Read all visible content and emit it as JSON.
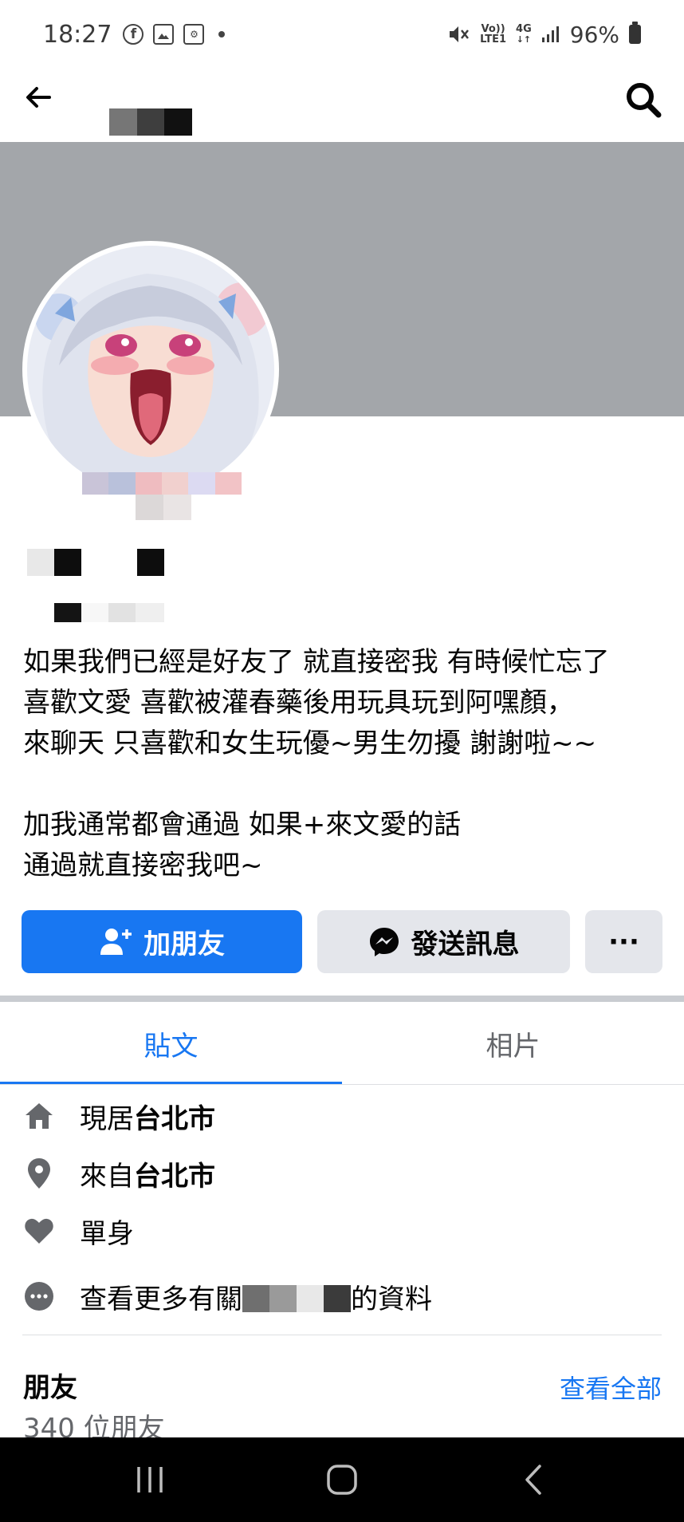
{
  "status_bar": {
    "time": "18:27",
    "left_icons": [
      "facebook-icon",
      "gallery-icon",
      "app-icon"
    ],
    "net_top": "Vo))",
    "net_bottom": "LTE1",
    "net_type": "4G",
    "battery": "96%"
  },
  "header": {
    "back_icon": "back-arrow-icon",
    "search_icon": "search-icon"
  },
  "profile": {
    "bio": "如果我們已經是好友了 就直接密我 有時候忙忘了\n喜歡文愛 喜歡被灌春藥後用玩具玩到阿嘿顏，\n來聊天 只喜歡和女生玩優~男生勿擾 謝謝啦~~\n\n加我通常都會通過 如果+來文愛的話\n通過就直接密我吧~"
  },
  "actions": {
    "add_friend": "加朋友",
    "send_message": "發送訊息",
    "more": "···"
  },
  "tabs": [
    {
      "label": "貼文",
      "active": true
    },
    {
      "label": "相片",
      "active": false
    }
  ],
  "details": {
    "lives_prefix": "現居",
    "lives_city": "台北市",
    "from_prefix": "來自",
    "from_city": "台北市",
    "relationship": "單身",
    "more_prefix": "查看更多有關",
    "more_suffix": "的資料"
  },
  "friends": {
    "title": "朋友",
    "see_all": "查看全部",
    "count": "340 位朋友"
  },
  "colors": {
    "accent": "#1877f2",
    "cover": "#a3a6aa",
    "button_gray": "#e4e6eb",
    "nav_bar": "#000000"
  }
}
